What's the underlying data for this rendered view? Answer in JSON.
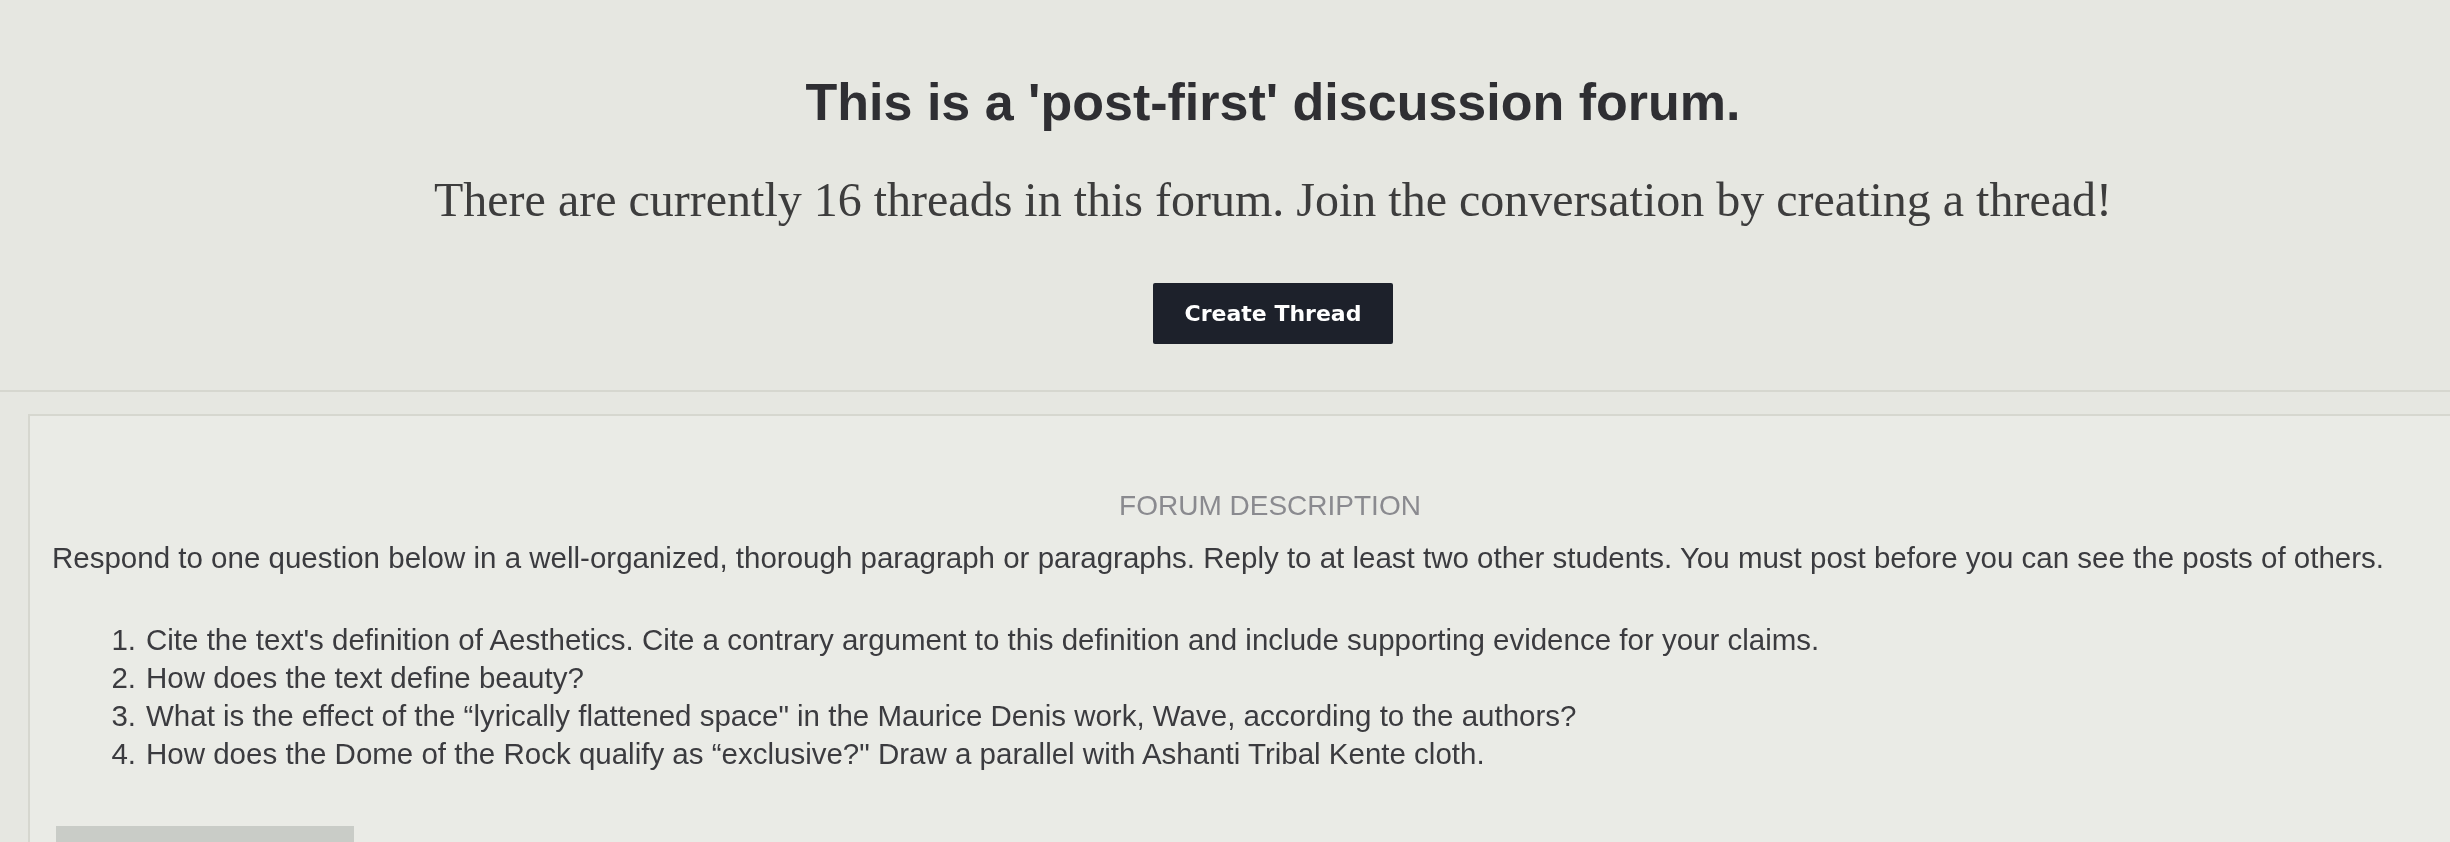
{
  "header": {
    "title": "This is a 'post-first' discussion forum.",
    "subtitle": "There are currently 16 threads in this forum. Join the conversation by creating a thread!",
    "button": "Create Thread"
  },
  "description": {
    "heading": "FORUM DESCRIPTION",
    "intro": "Respond to one question below in a well-organized, thorough paragraph or paragraphs. Reply to at least two other students. You must post before you can see the posts of others.",
    "questions": [
      {
        "number": "1.",
        "text": "Cite the text's definition of Aesthetics. Cite a contrary argument to this definition and include supporting evidence for your claims."
      },
      {
        "number": "2.",
        "text": "How does the text define beauty?"
      },
      {
        "number": "3.",
        "text": "What is the effect of the “lyrically flattened space\" in the Maurice Denis work, Wave, according to the authors?"
      },
      {
        "number": "4.",
        "text": "How does the Dome of the Rock qualify as “exclusive?\" Draw a parallel with Ashanti Tribal Kente cloth."
      }
    ]
  }
}
